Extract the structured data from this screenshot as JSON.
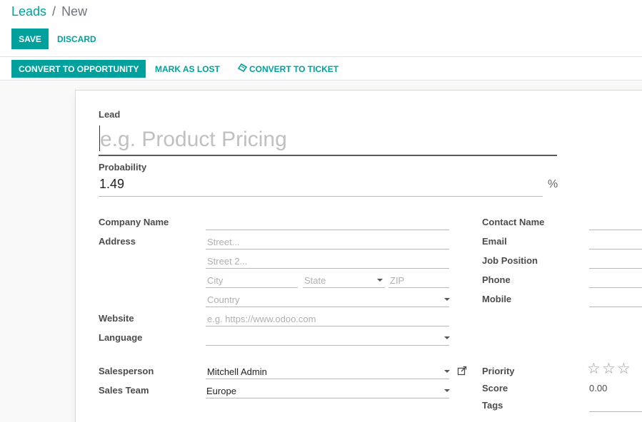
{
  "breadcrumb": {
    "parent": "Leads",
    "separator": "/",
    "current": "New"
  },
  "toolbar": {
    "save_label": "SAVE",
    "discard_label": "DISCARD"
  },
  "statusbar": {
    "convert_label": "CONVERT TO OPPORTUNITY",
    "lost_label": "MARK AS LOST",
    "ticket_label": "CONVERT TO TICKET",
    "ticket_icon": "ticket-icon"
  },
  "form": {
    "lead_label": "Lead",
    "lead_placeholder": "e.g. Product Pricing",
    "probability_label": "Probability",
    "probability_value": "1.49",
    "probability_unit": "%",
    "company_name_label": "Company Name",
    "address_label": "Address",
    "street_placeholder": "Street...",
    "street2_placeholder": "Street 2...",
    "city_placeholder": "City",
    "state_placeholder": "State",
    "zip_placeholder": "ZIP",
    "country_placeholder": "Country",
    "website_label": "Website",
    "website_placeholder": "e.g. https://www.odoo.com",
    "language_label": "Language",
    "salesperson_label": "Salesperson",
    "salesperson_value": "Mitchell Admin",
    "sales_team_label": "Sales Team",
    "sales_team_value": "Europe",
    "contact_name_label": "Contact Name",
    "email_label": "Email",
    "job_position_label": "Job Position",
    "phone_label": "Phone",
    "mobile_label": "Mobile",
    "priority_label": "Priority",
    "priority_stars": 0,
    "priority_max": 3,
    "score_label": "Score",
    "score_value": "0.00",
    "tags_label": "Tags"
  },
  "colors": {
    "accent": "#00a09d",
    "text": "#4c4c4c",
    "placeholder": "#b0b0b0"
  }
}
